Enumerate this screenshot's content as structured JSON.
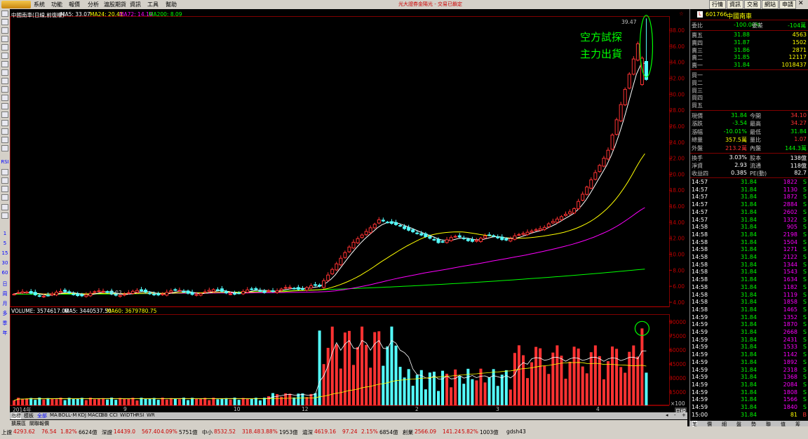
{
  "menu": {
    "items": [
      "系統",
      "功能",
      "報價",
      "分析",
      "滬股期貨",
      "資訊",
      "工具",
      "幫助"
    ],
    "center_text": "光大證券金陽光 - 交易已鎖定",
    "right_buttons": [
      "行情",
      "資訊",
      "交易",
      "網站",
      "申請"
    ]
  },
  "left_toolbar": {
    "period_labels": [
      "1",
      "5",
      "15",
      "30",
      "60",
      "日",
      "周",
      "月",
      "多",
      "季",
      "年"
    ],
    "rsi_label": "RSI"
  },
  "chart": {
    "title_line": [
      "中國南車(日線,前復權)",
      "MA5: 33.07",
      "MA24: 20.41",
      "MA72: 14.10",
      "MA200: 8.09"
    ],
    "price_axis": [
      "38.00",
      "36.00",
      "34.00",
      "32.00",
      "30.00",
      "28.00",
      "26.00",
      "24.00",
      "22.00",
      "20.00",
      "18.00",
      "16.00",
      "14.00",
      "12.00",
      "10.00",
      "8.00",
      "6.00",
      "4.00"
    ],
    "high_label": "39.47",
    "low_label": "5.03",
    "annotation_line1": "空方試探",
    "annotation_line2": "主力出貨",
    "volume_line": [
      "VOLUME: 3574617.00",
      "MA5: 3440537.50",
      "MA60: 3679780.75"
    ],
    "volume_axis": [
      "90000",
      "75000",
      "60000",
      "45000",
      "30000",
      "15000"
    ],
    "volume_unit": "×100",
    "time_labels": [
      "2014年",
      "9",
      "10",
      "12",
      "2",
      "3",
      "4"
    ],
    "period_btn": "日線",
    "colors": {
      "up": "#ff3232",
      "down": "#54ffff",
      "ma5": "#ffffff",
      "ma24": "#ffff00",
      "ma72": "#ff00ff",
      "ma200": "#00ff00",
      "annotation": "#00ff00"
    }
  },
  "tabs": [
    "指標",
    "模板",
    "全部",
    "MA",
    "BOLL-M",
    "KDJ",
    "MACD",
    "BB",
    "CCI",
    "WIDTH",
    "RSI",
    "WR"
  ],
  "tabs2": [
    "擴展區",
    "關聯報價"
  ],
  "right_panel": {
    "code": "601766",
    "name": "中國南車",
    "weibi_label": "委比",
    "weibi_value": "-100.00%",
    "weicha_label": "委差",
    "weicha_value": "-104萬",
    "asks": [
      {
        "label": "賣五",
        "price": "31.88",
        "vol": "4563"
      },
      {
        "label": "賣四",
        "price": "31.87",
        "vol": "1502"
      },
      {
        "label": "賣三",
        "price": "31.86",
        "vol": "2871"
      },
      {
        "label": "賣二",
        "price": "31.85",
        "vol": "12117"
      },
      {
        "label": "賣一",
        "price": "31.84",
        "vol": "1018437"
      }
    ],
    "bids": [
      "買一",
      "買二",
      "買三",
      "買四",
      "買五"
    ],
    "stats": [
      {
        "l1": "現價",
        "v1": "31.84",
        "l2": "今開",
        "v2": "34.10"
      },
      {
        "l1": "漲跌",
        "v1": "-3.54",
        "l2": "最高",
        "v2": "34.27"
      },
      {
        "l1": "漲幅",
        "v1": "-10.01%",
        "l2": "最低",
        "v2": "31.84"
      },
      {
        "l1": "總量",
        "v1": "357.5萬",
        "l2": "量比",
        "v2": "1.07"
      },
      {
        "l1": "外盤",
        "v1": "213.2萬",
        "l2": "內盤",
        "v2": "144.3萬"
      }
    ],
    "stats2": [
      {
        "l1": "換手",
        "v1": "3.03%",
        "l2": "股本",
        "v2": "138億"
      },
      {
        "l1": "淨資",
        "v1": "2.93",
        "l2": "流通",
        "v2": "118億"
      },
      {
        "l1": "收益四",
        "v1": "0.385",
        "l2": "PE(動)",
        "v2": "82.7"
      }
    ],
    "ticks": [
      {
        "t": "14:57",
        "p": "31.84",
        "v": "1822",
        "f": "S"
      },
      {
        "t": "14:57",
        "p": "31.84",
        "v": "1130",
        "f": "S"
      },
      {
        "t": "14:57",
        "p": "31.84",
        "v": "1872",
        "f": "S"
      },
      {
        "t": "14:57",
        "p": "31.84",
        "v": "2884",
        "f": "S"
      },
      {
        "t": "14:57",
        "p": "31.84",
        "v": "2602",
        "f": "S"
      },
      {
        "t": "14:57",
        "p": "31.84",
        "v": "1322",
        "f": "S"
      },
      {
        "t": "14:58",
        "p": "31.84",
        "v": "905",
        "f": "S"
      },
      {
        "t": "14:58",
        "p": "31.84",
        "v": "2198",
        "f": "S"
      },
      {
        "t": "14:58",
        "p": "31.84",
        "v": "1504",
        "f": "S"
      },
      {
        "t": "14:58",
        "p": "31.84",
        "v": "1271",
        "f": "S"
      },
      {
        "t": "14:58",
        "p": "31.84",
        "v": "2122",
        "f": "S"
      },
      {
        "t": "14:58",
        "p": "31.84",
        "v": "1344",
        "f": "S"
      },
      {
        "t": "14:58",
        "p": "31.84",
        "v": "1543",
        "f": "S"
      },
      {
        "t": "14:58",
        "p": "31.84",
        "v": "1634",
        "f": "S"
      },
      {
        "t": "14:58",
        "p": "31.84",
        "v": "1182",
        "f": "S"
      },
      {
        "t": "14:58",
        "p": "31.84",
        "v": "1119",
        "f": "S"
      },
      {
        "t": "14:58",
        "p": "31.84",
        "v": "1858",
        "f": "S"
      },
      {
        "t": "14:58",
        "p": "31.84",
        "v": "1465",
        "f": "S"
      },
      {
        "t": "14:59",
        "p": "31.84",
        "v": "1352",
        "f": "S"
      },
      {
        "t": "14:59",
        "p": "31.84",
        "v": "1870",
        "f": "S"
      },
      {
        "t": "14:59",
        "p": "31.84",
        "v": "2668",
        "f": "S"
      },
      {
        "t": "14:59",
        "p": "31.84",
        "v": "2431",
        "f": "S"
      },
      {
        "t": "14:59",
        "p": "31.84",
        "v": "1533",
        "f": "S"
      },
      {
        "t": "14:59",
        "p": "31.84",
        "v": "1142",
        "f": "S"
      },
      {
        "t": "14:59",
        "p": "31.84",
        "v": "1892",
        "f": "S"
      },
      {
        "t": "14:59",
        "p": "31.84",
        "v": "2318",
        "f": "S"
      },
      {
        "t": "14:59",
        "p": "31.84",
        "v": "1368",
        "f": "S"
      },
      {
        "t": "14:59",
        "p": "31.84",
        "v": "2084",
        "f": "S"
      },
      {
        "t": "14:59",
        "p": "31.84",
        "v": "1808",
        "f": "S"
      },
      {
        "t": "14:59",
        "p": "31.84",
        "v": "1566",
        "f": "S"
      },
      {
        "t": "14:59",
        "p": "31.84",
        "v": "1840",
        "f": "S"
      },
      {
        "t": "15:00",
        "p": "31.84",
        "v": "81",
        "f": "B"
      }
    ],
    "bottom_tabs": [
      "笔",
      "價",
      "細",
      "盤",
      "勢",
      "聯",
      "值",
      "筹"
    ]
  },
  "bottom_bar": {
    "items": [
      {
        "name": "上證",
        "val": "4293.62",
        "chg": "76.54",
        "pct": "1.82%",
        "amt": "6624億"
      },
      {
        "name": "深證",
        "val": "14439.0",
        "chg": "567.40",
        "pct": "4.09%",
        "amt": "5751億"
      },
      {
        "name": "中小",
        "val": "8532.52",
        "chg": "318.48",
        "pct": "3.88%",
        "amt": "1953億"
      },
      {
        "name": "滬深",
        "val": "4619.16",
        "chg": "97.24",
        "pct": "2.15%",
        "amt": "6854億"
      },
      {
        "name": "創業",
        "val": "2566.09",
        "chg": "141.24",
        "pct": "5.82%",
        "amt": "1003億"
      }
    ],
    "server": "gdsh43"
  }
}
